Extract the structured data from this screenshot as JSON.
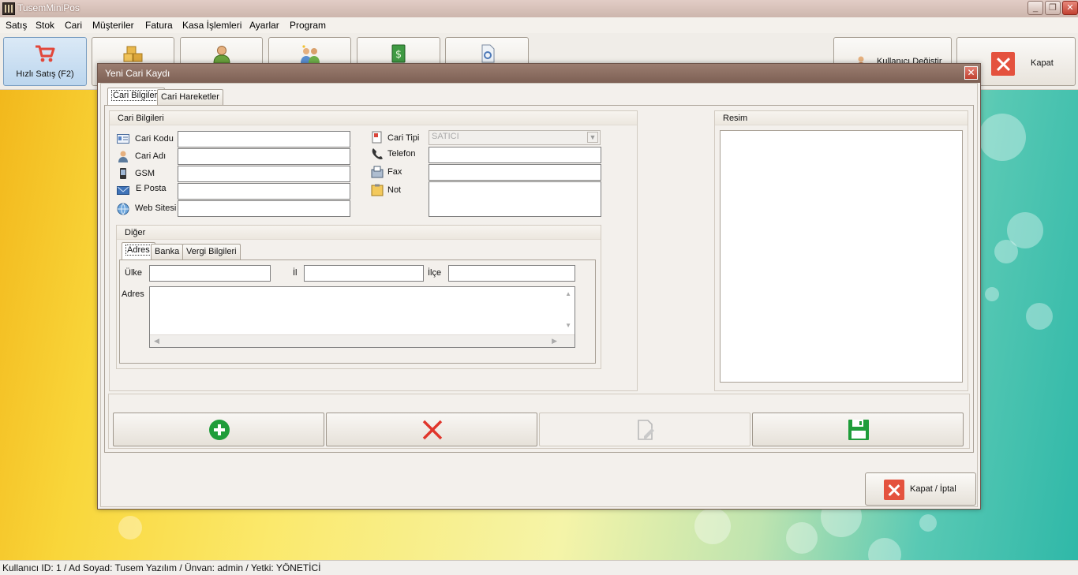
{
  "window": {
    "title": "TusemMiniPos"
  },
  "menu": [
    "Satış",
    "Stok",
    "Cari",
    "Müşteriler",
    "Fatura",
    "Kasa İşlemleri",
    "Ayarlar",
    "Program"
  ],
  "toolbar": {
    "quick_sale_label": "Hızlı Satış (F2)",
    "change_user_label": "Kullanıcı Değiştir",
    "close_label": "Kapat"
  },
  "dialog": {
    "title": "Yeni Cari Kaydı",
    "tabs": [
      "Cari Bilgileri",
      "Cari Hareketler"
    ],
    "group_title": "Cari Bilgileri",
    "fields": {
      "code_label": "Cari Kodu",
      "name_label": "Cari Adı",
      "gsm_label": "GSM",
      "email_label": "E Posta",
      "website_label": "Web Sitesi",
      "type_label": "Cari Tipi",
      "type_value": "SATICI",
      "phone_label": "Telefon",
      "fax_label": "Fax",
      "note_label": "Not"
    },
    "other": {
      "title": "Diğer",
      "tabs": [
        "Adres",
        "Banka",
        "Vergi Bilgileri"
      ],
      "country_label": "Ülke",
      "city_label": "İl",
      "district_label": "İlçe",
      "address_label": "Adres"
    },
    "image_group_title": "Resim",
    "cancel_close_label": "Kapat / İptal"
  },
  "status": {
    "text": "Kullanıcı ID: 1 / Ad Soyad: Tusem Yazılım / Ünvan: admin / Yetki: YÖNETİCİ"
  },
  "colors": {
    "accent_green": "#1f9d3a",
    "accent_red": "#e4523e",
    "dialog_title": "#8a6c60"
  }
}
